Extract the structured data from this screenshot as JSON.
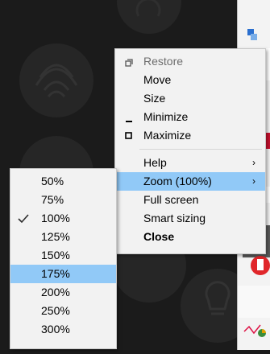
{
  "system_menu": {
    "items": [
      {
        "label": "Restore",
        "icon": "restore-icon",
        "disabled": true
      },
      {
        "label": "Move"
      },
      {
        "label": "Size"
      },
      {
        "label": "Minimize",
        "icon": "minimize-icon"
      },
      {
        "label": "Maximize",
        "icon": "maximize-icon"
      },
      {
        "label": "Help",
        "submenu": true
      },
      {
        "label": "Zoom (100%)",
        "submenu": true,
        "highlighted": true
      },
      {
        "label": "Full screen"
      },
      {
        "label": "Smart sizing"
      },
      {
        "label": "Close",
        "bold": true
      }
    ]
  },
  "zoom_menu": {
    "items": [
      {
        "label": "50%"
      },
      {
        "label": "75%"
      },
      {
        "label": "100%",
        "checked": true
      },
      {
        "label": "125%"
      },
      {
        "label": "150%"
      },
      {
        "label": "175%",
        "highlighted": true
      },
      {
        "label": "200%"
      },
      {
        "label": "250%"
      },
      {
        "label": "300%"
      }
    ]
  },
  "submenu_arrow": "›",
  "colors": {
    "highlight": "#91c9f7",
    "menu_bg": "#f2f2f2",
    "disabled_text": "#6d6d6d"
  }
}
